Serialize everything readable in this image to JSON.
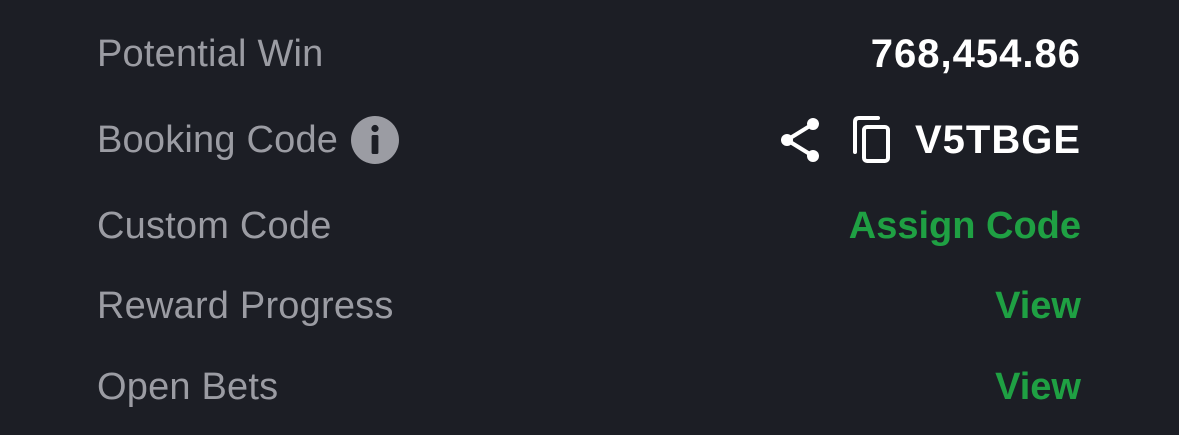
{
  "rows": {
    "potential_win": {
      "label": "Potential Win",
      "value": "768,454.86"
    },
    "booking_code": {
      "label": "Booking Code",
      "value": "V5TBGE",
      "info_icon": "info-icon",
      "share_icon": "share-icon",
      "copy_icon": "copy-icon"
    },
    "custom_code": {
      "label": "Custom Code",
      "action": "Assign Code"
    },
    "reward_progress": {
      "label": "Reward Progress",
      "action": "View"
    },
    "open_bets": {
      "label": "Open Bets",
      "action": "View"
    }
  },
  "colors": {
    "background": "#1c1e25",
    "label": "#9b9ca3",
    "value": "#ffffff",
    "action_green": "#1fa043"
  }
}
